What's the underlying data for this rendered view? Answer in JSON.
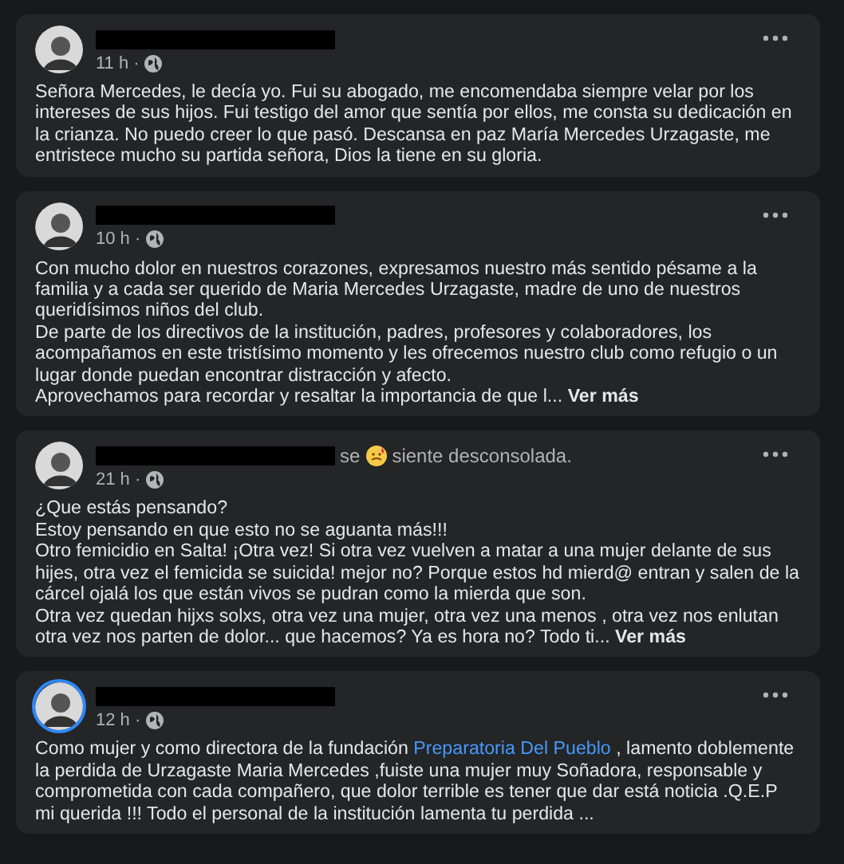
{
  "posts": [
    {
      "time": "11 h ·",
      "story_ring": false,
      "paragraphs": [
        [
          {
            "text": "Señora Mercedes, le decía yo. Fui su abogado, me encomendaba siempre velar por los intereses de sus hijos. Fui testigo del amor que sentía por ellos, me consta su dedicación en la crianza. No puedo creer lo que pasó. Descansa en paz María Mercedes Urzagaste, me entristece mucho su partida señora, Dios la tiene en su gloria."
          }
        ]
      ]
    },
    {
      "time": "10 h ·",
      "story_ring": false,
      "paragraphs": [
        [
          {
            "text": "Con mucho dolor en nuestros corazones, expresamos nuestro más sentido pésame a la familia y a cada ser querido de Maria Mercedes  Urzagaste, madre de uno de nuestros queridísimos niños del club."
          }
        ],
        [
          {
            "text": "De parte de los directivos de la institución, padres, profesores y colaboradores, los acompañamos en este tristísimo momento y les ofrecemos nuestro club como refugio o un lugar donde puedan encontrar distracción y afecto."
          }
        ],
        [
          {
            "text": "Aprovechamos para recordar y resaltar la importancia de que l... "
          },
          {
            "text": "Ver más",
            "kind": "more"
          }
        ]
      ]
    },
    {
      "time": "21 h ·",
      "story_ring": false,
      "feeling": {
        "before": "se",
        "after": "siente desconsolada."
      },
      "paragraphs": [
        [
          {
            "text": "¿Que estás pensando?"
          }
        ],
        [
          {
            "text": "Estoy pensando en que esto no se aguanta más!!!"
          }
        ],
        [
          {
            "text": "Otro femicidio en Salta! ¡Otra vez! Si otra vez vuelven a matar a una mujer delante de sus hijes, otra vez el femicida se suicida! mejor no? Porque estos hd mierd@ entran y salen de la cárcel ojalá los que están vivos se pudran como la mierda que son."
          }
        ],
        [
          {
            "text": "Otra vez quedan hijxs solxs, otra vez una mujer, otra vez una menos , otra vez nos enlutan otra vez nos parten de dolor... que hacemos? Ya es hora no? Todo ti... "
          },
          {
            "text": "Ver más",
            "kind": "more"
          }
        ]
      ]
    },
    {
      "time": "12 h ·",
      "story_ring": true,
      "paragraphs": [
        [
          {
            "text": "Como mujer y como directora de la fundación "
          },
          {
            "text": "Preparatoria Del Pueblo",
            "kind": "link"
          },
          {
            "text": " , lamento doblemente la perdida  de Urzagaste Maria Mercedes  ,fuiste una mujer muy Soñadora, responsable y comprometida con cada compañero, que dolor terrible es tener que dar está noticia .Q.E.P mi querida !!! Todo el personal de la institución lamenta tu perdida ..."
          }
        ]
      ]
    }
  ]
}
